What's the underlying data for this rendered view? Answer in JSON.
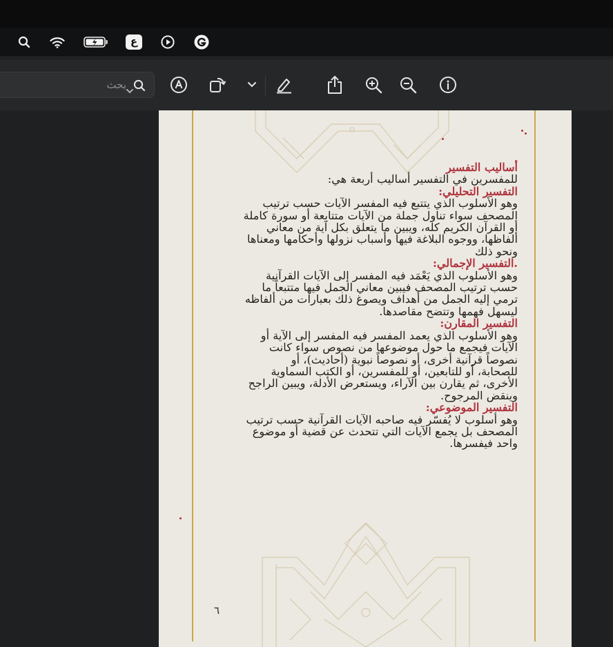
{
  "menubar": {
    "icons": [
      "search-icon",
      "wifi-icon",
      "battery-icon",
      "input-source-icon",
      "play-icon",
      "app-icon"
    ],
    "input_source_label": "ع"
  },
  "toolbar": {
    "search_placeholder": "بحث",
    "buttons": [
      "markup-icon",
      "rotate-icon",
      "chevron-down-icon",
      "highlight-icon",
      "share-icon",
      "zoom-in-icon",
      "zoom-out-icon",
      "info-icon"
    ]
  },
  "document": {
    "section_title": "أساليب التفسير",
    "intro": "للمفسرين في التفسير أساليب أربعة هي:",
    "sections": [
      {
        "heading": "التفسير التحليلي:",
        "lines": [
          "وهو الأسلوب الذي يتتبع فيه المفسر الآيات حسب ترتيب",
          "المصحف سواء تناول جملة من الآيات متتابعة أو سورة كاملة",
          "أو القرآن الكريم كله، ويبين ما يتعلق بكل آية من معاني",
          "ألفاظها، ووجوه البلاغة فيها وأسباب نزولها وأحكامها ومعناها",
          "ونحو ذلك"
        ]
      },
      {
        "heading": ".التفسير الإجمالي:",
        "lines": [
          "وهو الأسلوب الذي يَعْمَد فيه المفسر إلى الآيات القرآنية",
          "حسب ترتيب المصحف فيبين معاني الجمل فيها متتبعاً ما",
          "ترمي إليه الجمل من أهداف ويصوغ ذلك بعبارات من ألفاظه",
          "ليسهل فهمها وتتضح مقاصدها."
        ]
      },
      {
        "heading": "التفسير المقارن:",
        "lines": [
          "وهو الأسلوب الذي يعمد المفسر فيه المفسر إلى الآية أو",
          "الآيات فيجمع ما حول موضوعها من نصوص سواء كانت",
          "نصوصاً قرآنية أخرى، أو نصوصاً نبوية (أحاديث)، أو",
          "للصحابة، أو للتابعين، أو للمفسرين، أو الكتب السماوية",
          "الأخرى، ثم يقارن بين الآراء، ويستعرض الأدلة، ويبين الراجح",
          "وينقض المرجوح."
        ]
      },
      {
        "heading": "التفسير الموضوعي:",
        "lines": [
          "وهو أسلوب لا يُفسّر فيه صاحبه الآيات القرآنية حسب ترتيب",
          "المصحف بل يجمع الآيات التي تتحدث عن قضية أو موضوع",
          "واحد فيفسرها."
        ]
      }
    ],
    "page_number": "٦"
  }
}
